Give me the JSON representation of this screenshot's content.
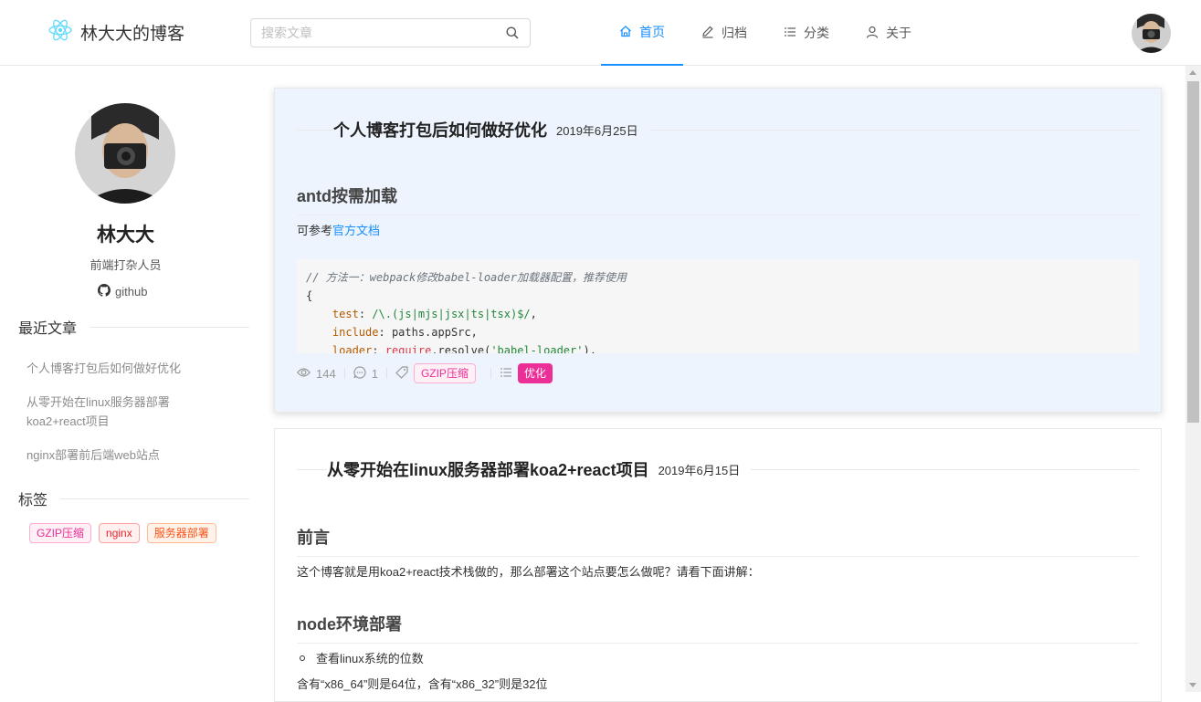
{
  "header": {
    "logo_text": "林大大的博客",
    "search_placeholder": "搜索文章",
    "nav": [
      {
        "label": "首页",
        "icon": "home-icon",
        "active": true
      },
      {
        "label": "归档",
        "icon": "edit-icon",
        "active": false
      },
      {
        "label": "分类",
        "icon": "list-icon",
        "active": false
      },
      {
        "label": "关于",
        "icon": "user-icon",
        "active": false
      }
    ]
  },
  "sidebar": {
    "name": "林大大",
    "description": "前端打杂人员",
    "github_label": "github",
    "recent_title": "最近文章",
    "recent_items": [
      "个人博客打包后如何做好优化",
      "从零开始在linux服务器部署koa2+react项目",
      "nginx部署前后端web站点"
    ],
    "tags_title": "标签",
    "tags": [
      "GZIP压缩",
      "nginx",
      "服务器部署"
    ]
  },
  "articles": [
    {
      "title": "个人博客打包后如何做好优化",
      "date": "2019年6月25日",
      "h2": "antd按需加载",
      "p_prefix": "可参考",
      "p_link": "官方文档",
      "code": {
        "comment": "// 方法一：webpack修改babel-loader加载器配置，推荐使用",
        "open_brace": "{",
        "test_key": "test",
        "test_val": "/\\.(js|mjs|jsx|ts|tsx)$/",
        "include_key": "include",
        "include_val": "paths.appSrc,",
        "loader_key": "loader",
        "loader_fn": "require",
        "loader_rest": ".resolve(",
        "loader_str": "'babel-loader'",
        "loader_end": "),"
      },
      "views": "144",
      "comments": "1",
      "tag": "GZIP压缩",
      "category": "优化"
    },
    {
      "title": "从零开始在linux服务器部署koa2+react项目",
      "date": "2019年6月15日",
      "h2_1": "前言",
      "p_1": "这个博客就是用koa2+react技术栈做的，那么部署这个站点要怎么做呢？请看下面讲解：",
      "h2_2": "node环境部署",
      "bullet_1": "查看linux系统的位数",
      "p_2": "含有“x86_64”则是64位，含有“x86_32”则是32位"
    }
  ],
  "colors": {
    "accent": "#1890ff",
    "hover_bg": "#edf4fd",
    "category_tag": "#eb2f96"
  }
}
